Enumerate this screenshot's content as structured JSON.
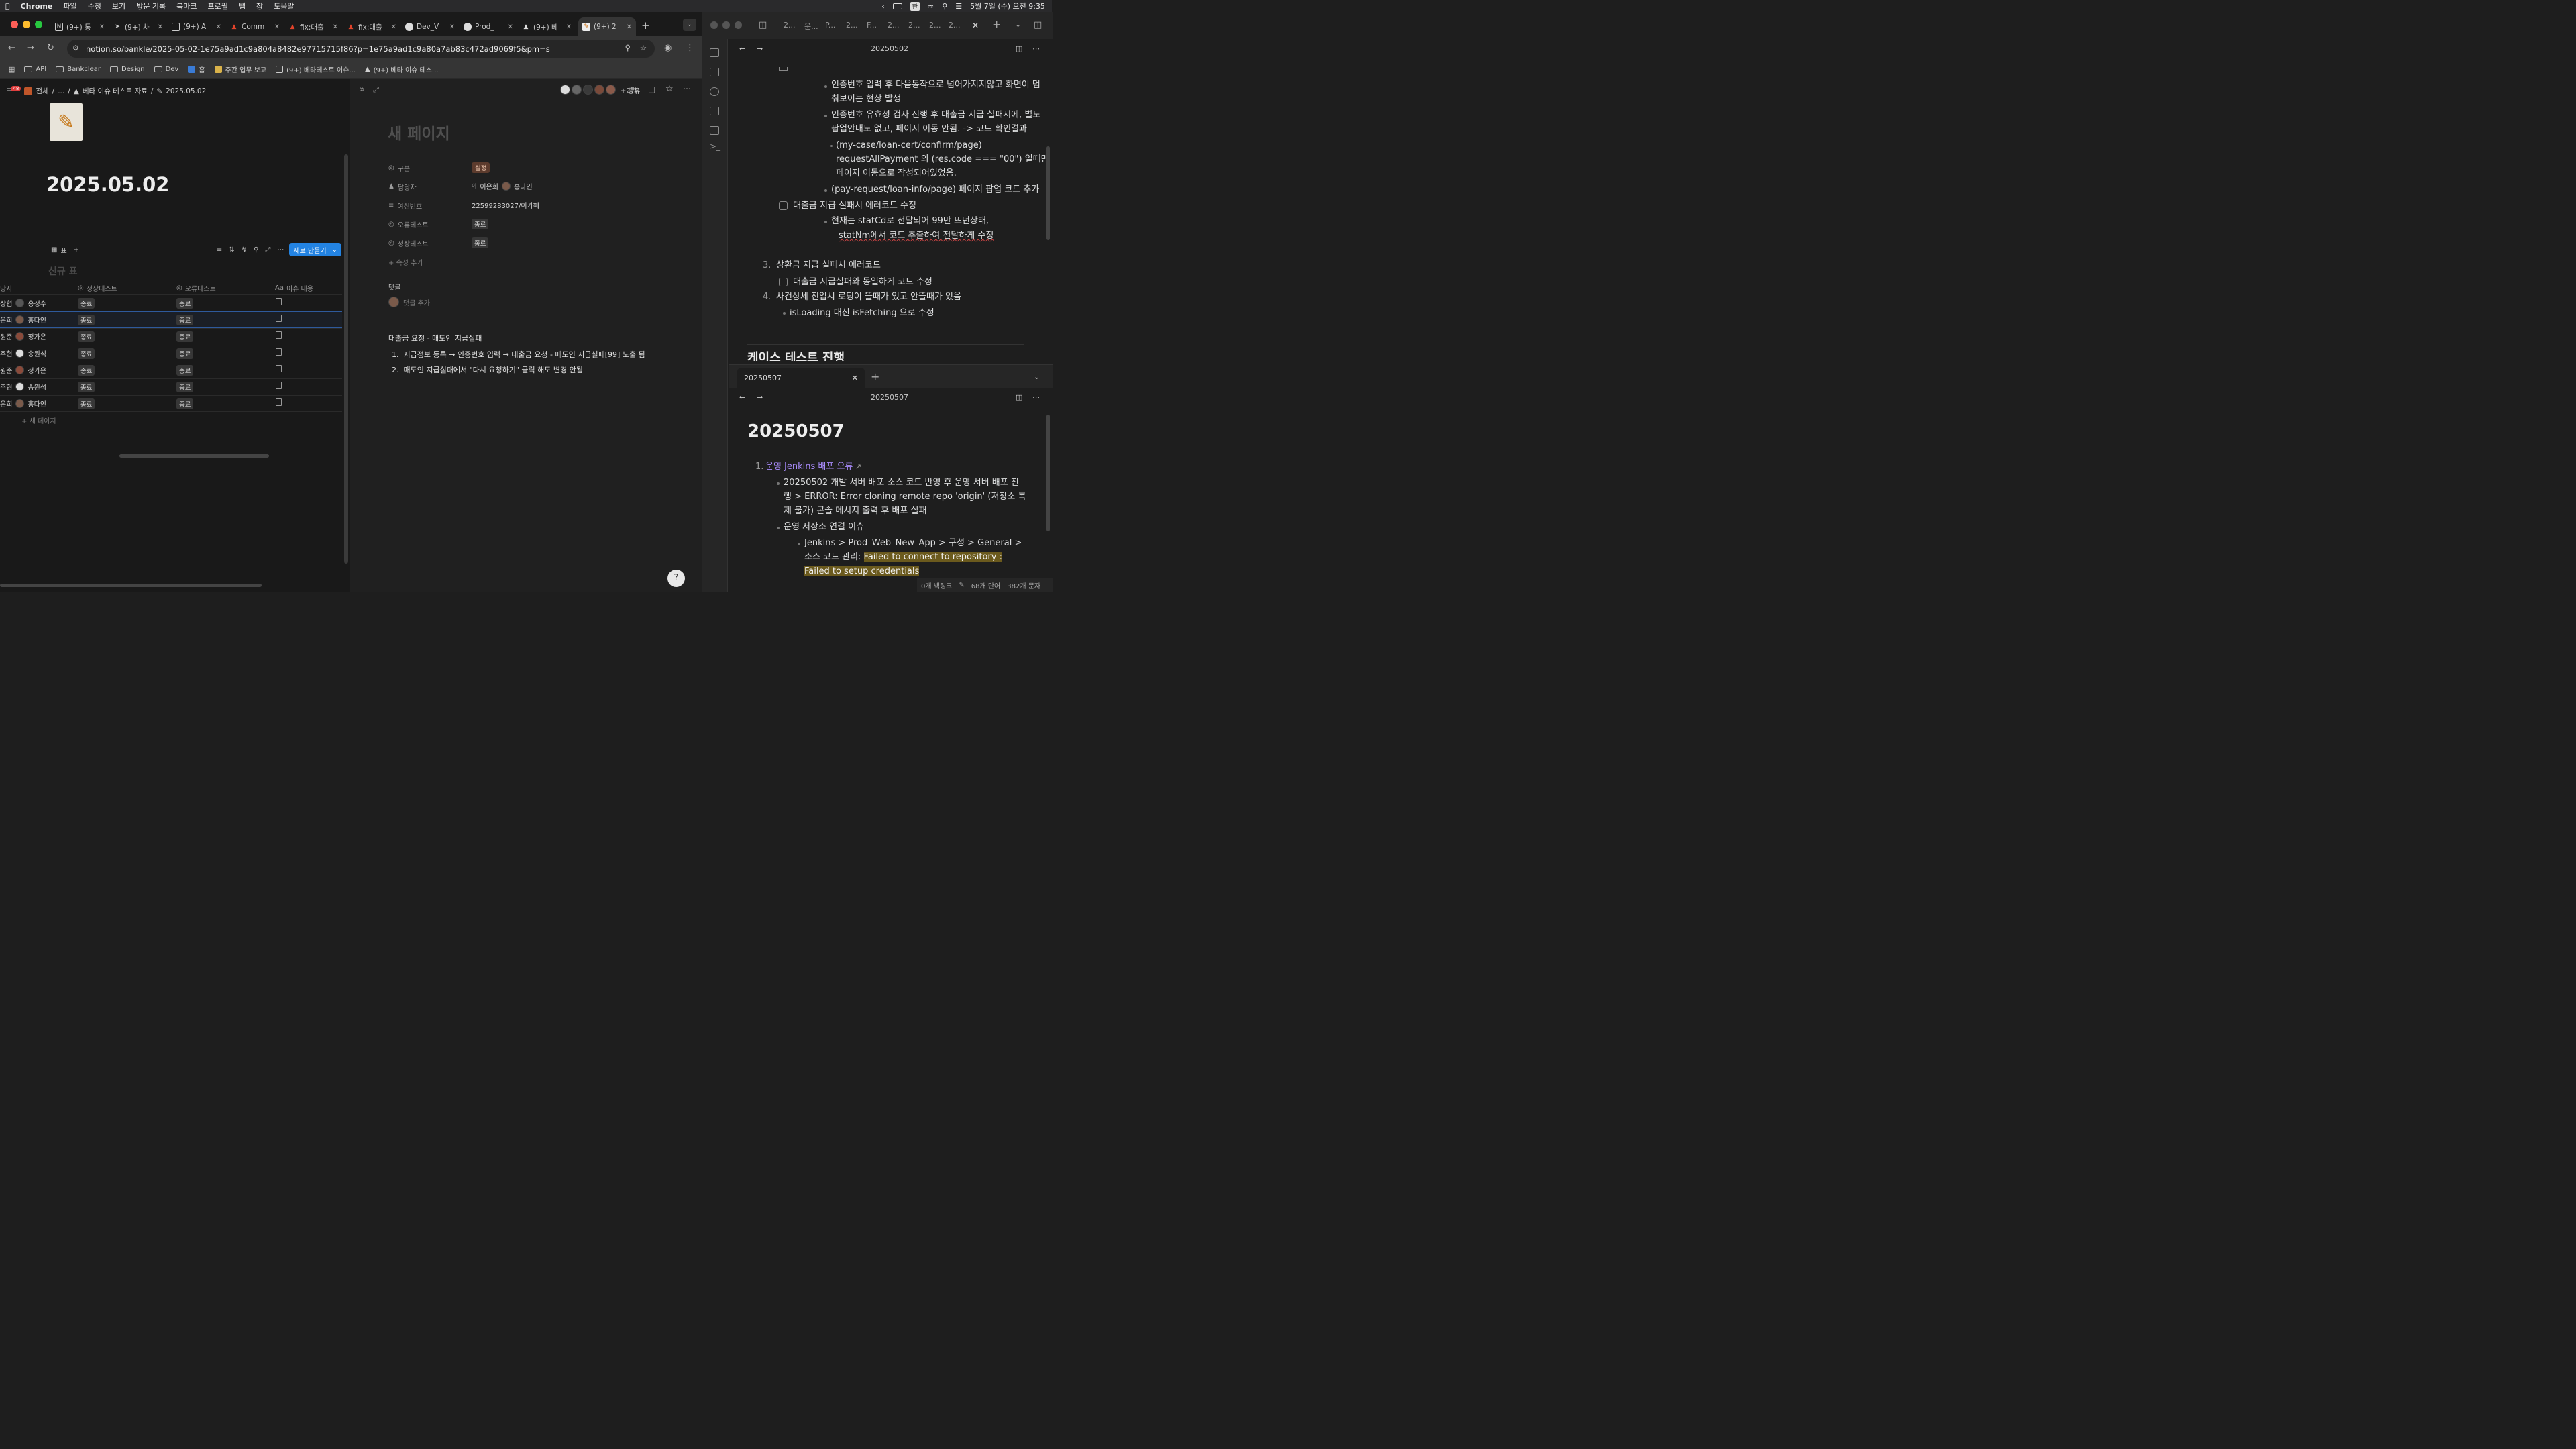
{
  "menubar": {
    "app": "Chrome",
    "items": [
      "파일",
      "수정",
      "보기",
      "방문 기록",
      "북마크",
      "프로필",
      "탭",
      "창",
      "도움말"
    ],
    "datetime": "5월 7일 (수) 오전 9:35",
    "input_method": "한"
  },
  "chrome": {
    "tabs": [
      {
        "label": "(9+) 통",
        "icon": "notion-icon"
      },
      {
        "label": "(9+) 차",
        "icon": "bird-icon"
      },
      {
        "label": "(9+) A",
        "icon": "page-icon"
      },
      {
        "label": "Comm",
        "icon": "gitlab-icon"
      },
      {
        "label": "fix:대출",
        "icon": "gitlab-icon"
      },
      {
        "label": "fix:대출",
        "icon": "gitlab-icon"
      },
      {
        "label": "Dev_V",
        "icon": "jenkins-icon"
      },
      {
        "label": "Prod_",
        "icon": "jenkins-icon"
      },
      {
        "label": "(9+) 베",
        "icon": "person-icon"
      },
      {
        "label": "(9+) 2",
        "icon": "pencil-icon"
      }
    ],
    "url": "notion.so/bankle/2025-05-02-1e75a9ad1c9a804a8482e97715715f86?p=1e75a9ad1c9a80a7ab83c472ad9069f5&pm=s",
    "bookmarks": [
      "API",
      "Bankclear",
      "Design",
      "Dev",
      "홈",
      "주간 업무 보고",
      "(9+) 베타테스트 이슈...",
      "(9+) 베타 이슈 테스..."
    ]
  },
  "notion": {
    "breadcrumb": {
      "badge": "48",
      "items": [
        "전체",
        "...",
        "베타 이슈 테스트 자료",
        "2025.05.02"
      ]
    },
    "page_title": "2025.05.02",
    "db_view": {
      "view_label": "표",
      "new_button": "새로 만들기",
      "table_title": "신규 표"
    },
    "columns": [
      "당자",
      "정상테스트",
      "오류테스트",
      "이슈 내용"
    ],
    "rows": [
      {
        "first": "상협",
        "person": "홍정수",
        "normal": "종료",
        "error": "종료"
      },
      {
        "first": "은희",
        "person": "홍다인",
        "normal": "종료",
        "error": "종료"
      },
      {
        "first": "원준",
        "person": "정가은",
        "normal": "종료",
        "error": "종료"
      },
      {
        "first": "주현",
        "person": "송원석",
        "normal": "종료",
        "error": "종료"
      },
      {
        "first": "원준",
        "person": "정가은",
        "normal": "종료",
        "error": "종료"
      },
      {
        "first": "주현",
        "person": "송원석",
        "normal": "종료",
        "error": "종료"
      },
      {
        "first": "은희",
        "person": "홍다인",
        "normal": "종료",
        "error": "종료"
      }
    ],
    "new_page": "새 페이지",
    "peek": {
      "share": "공유",
      "extra_people": "+2명",
      "title_placeholder": "새 페이지",
      "props": [
        {
          "key": "구분",
          "value": "설정"
        },
        {
          "key": "담당자",
          "value": "이은희",
          "value2": "홍다인",
          "initial": "이"
        },
        {
          "key": "여신번호",
          "value": "22599283027/이가혜"
        },
        {
          "key": "오류테스트",
          "value": "종료"
        },
        {
          "key": "정상테스트",
          "value": "종료"
        }
      ],
      "add_prop": "속성 추가",
      "comments_label": "댓글",
      "comment_add": "댓글 추가",
      "body_heading": "대출금 요청 - 매도인 지급실패",
      "body_items": [
        "지급정보 등록 → 인증번호 입력 → 대출금 요청 - 매도인 지급실패[99] 노출 됨",
        "매도인 지급실패에서 \"다시 요청하기\" 클릭 해도 변경 안됨"
      ]
    }
  },
  "obsidian": {
    "top_tabs": [
      "2...",
      "운...",
      "P...",
      "2...",
      "F...",
      "2...",
      "2...",
      "2...",
      "2..."
    ],
    "pane1": {
      "title": "20250502",
      "lines": [
        "인증번호 입력 후 다음동작으로 넘어가지지않고 화면이 멈",
        "춰보이는 현상 발생",
        "인증번호 유효성 검사 진행 후 대출금 지급 실패시에, 별도",
        "팝업안내도 없고, 페이지 이동 안됨. -> 코드 확인결과",
        "(my-case/loan-cert/confirm/page)",
        "requestAllPayment 의 (res.code === \"00\") 일때만",
        "페이지 이동으로 작성되어있었음.",
        "(pay-request/loan-info/page) 페이지 팝업 코드 추가",
        "대출금 지급 실패시 에러코드 수정",
        "현재는 statCd로 전달되어 99만 뜨던상태,",
        "statNm에서 코드 추출하여 전달하게 수정",
        "상환금 지급 실패시 에러코드",
        "대출금 지급실패와 동일하게 코드 수정",
        "사건상세 진입시 로딩이 뜰때가 있고 안뜰때가 있음",
        "isLoading 대신 isFetching 으로 수정"
      ],
      "nums": [
        "3.",
        "4."
      ],
      "heading": "케이스 테스트 진행"
    },
    "pane2": {
      "tab": "20250507",
      "title": "20250507",
      "h1": "20250507",
      "link": "운영 Jenkins 배포 오류",
      "lines": [
        "20250502 개발 서버 배포 소스 코드 반영 후 운영 서버 배포 진",
        "행 > ERROR: Error cloning remote repo 'origin' (저장소 복",
        "제 불가) 콘솔 메시지 출력 후 배포 실패",
        "운영 저장소 연결 이슈",
        "Jenkins > Prod_Web_New_App > 구성 > General >",
        "소스 코드 관리: ",
        "Failed to connect to repository :",
        "Failed to setup credentials"
      ]
    },
    "status": {
      "backlinks": "0개 백링크",
      "words": "68개 단어",
      "chars": "382개 문자"
    }
  }
}
